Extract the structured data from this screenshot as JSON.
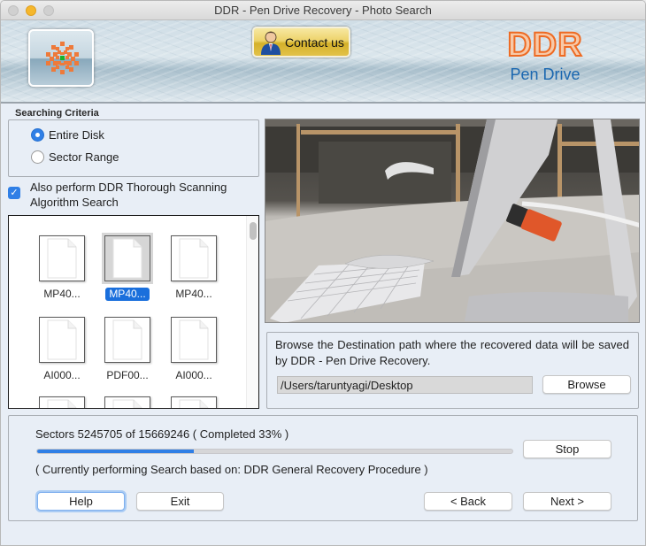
{
  "window": {
    "title": "DDR - Pen Drive Recovery - Photo Search"
  },
  "header": {
    "contact_label": "Contact us",
    "brand_name": "DDR",
    "brand_sub": "Pen Drive"
  },
  "criteria": {
    "legend": "Searching Criteria",
    "options": [
      {
        "label": "Entire Disk",
        "selected": true
      },
      {
        "label": "Sector Range",
        "selected": false
      }
    ],
    "thorough_checkbox": {
      "label": "Also perform DDR Thorough Scanning Algorithm Search",
      "checked": true
    }
  },
  "files": [
    {
      "label": "MP40...",
      "selected": false
    },
    {
      "label": "MP40...",
      "selected": true
    },
    {
      "label": "MP40...",
      "selected": false
    },
    {
      "label": "AI000...",
      "selected": false
    },
    {
      "label": "PDF00...",
      "selected": false
    },
    {
      "label": "AI000...",
      "selected": false
    },
    {
      "label": "",
      "selected": false
    },
    {
      "label": "",
      "selected": false
    },
    {
      "label": "",
      "selected": false
    }
  ],
  "destination": {
    "description": "Browse the Destination path where the recovered data will be saved by DDR - Pen Drive Recovery.",
    "path": "/Users/taruntyagi/Desktop",
    "browse_label": "Browse"
  },
  "progress": {
    "sectors_text": "Sectors 5245705 of 15669246   ( Completed 33% )",
    "sectors_done": 5245705,
    "sectors_total": 15669246,
    "percent": 33,
    "status_text": "( Currently performing Search based on: DDR General Recovery Procedure )",
    "stop_label": "Stop"
  },
  "footer": {
    "help_label": "Help",
    "exit_label": "Exit",
    "back_label": "< Back",
    "next_label": "Next >"
  },
  "colors": {
    "accent": "#2f7fe6",
    "brand_orange": "#ee6a22",
    "brand_blue": "#1a67b0"
  }
}
